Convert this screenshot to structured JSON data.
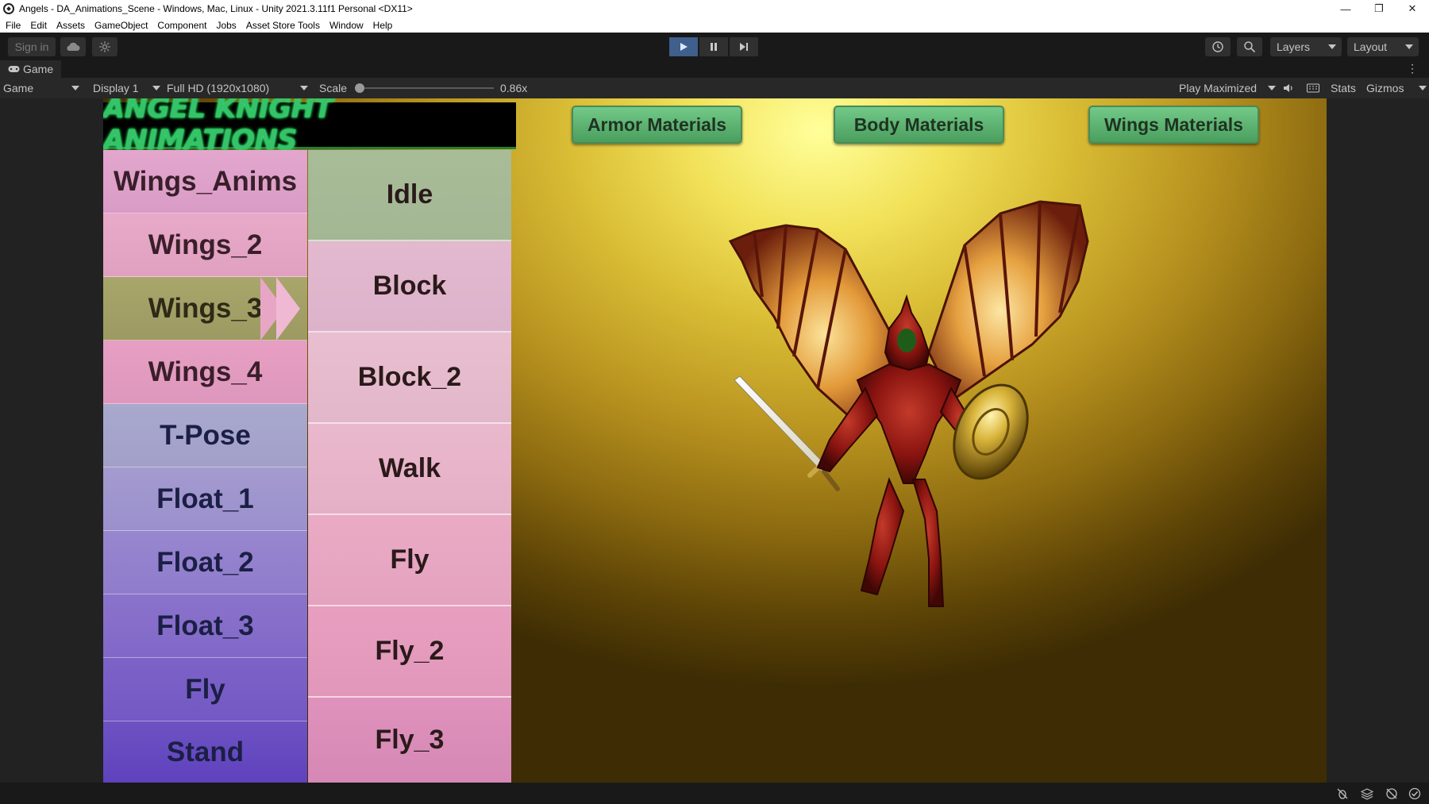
{
  "window": {
    "title": "Angels - DA_Animations_Scene - Windows, Mac, Linux - Unity 2021.3.11f1 Personal <DX11>",
    "controls": [
      "—",
      "❐",
      "✕"
    ]
  },
  "menu": [
    "File",
    "Edit",
    "Assets",
    "GameObject",
    "Component",
    "Jobs",
    "Asset Store Tools",
    "Window",
    "Help"
  ],
  "toolbar": {
    "sign_in": "Sign in",
    "layers": "Layers",
    "layout": "Layout"
  },
  "game_tab": {
    "label": "Game"
  },
  "view_controls": {
    "mode": "Game",
    "display": "Display 1",
    "resolution": "Full HD (1920x1080)",
    "scale_label": "Scale",
    "scale_value": "0.86x",
    "play_maximized": "Play Maximized",
    "stats": "Stats",
    "gizmos": "Gizmos"
  },
  "game": {
    "banner": "ANGEL KNIGHT ANIMATIONS",
    "material_buttons": [
      "Armor Materials",
      "Body Materials",
      "Wings Materials"
    ],
    "left_list": [
      "Wings_Anims",
      "Wings_2",
      "Wings_3",
      "Wings_4",
      "T-Pose",
      "Float_1",
      "Float_2",
      "Float_3",
      "Fly",
      "Stand"
    ],
    "left_selected": "Wings_3",
    "right_list": [
      "Idle",
      "Block",
      "Block_2",
      "Walk",
      "Fly",
      "Fly_2",
      "Fly_3"
    ],
    "right_selected": "Idle"
  },
  "colors": {
    "editor_bg": "#191919",
    "play_active": "#3f5f8c",
    "banner_text": "#37c26a",
    "material_button": "#5fb374"
  }
}
